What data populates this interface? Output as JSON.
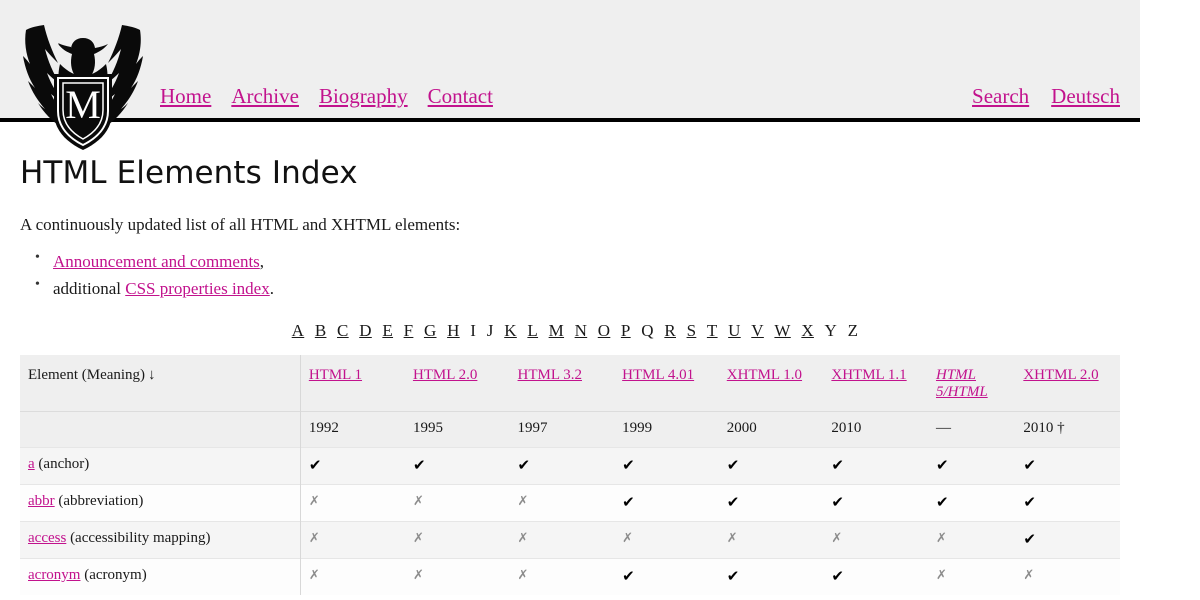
{
  "header": {
    "logo_icon": "eagle-shield-logo",
    "logo_letter": "M",
    "nav_left": [
      {
        "label": "Home"
      },
      {
        "label": "Archive"
      },
      {
        "label": "Biography"
      },
      {
        "label": "Contact"
      }
    ],
    "nav_right": [
      {
        "label": "Search"
      },
      {
        "label": "Deutsch"
      }
    ]
  },
  "main": {
    "title": "HTML Elements Index",
    "lede": "A continuously updated list of all HTML and XHTML elements:",
    "bullets": [
      {
        "link": "Announcement and comments",
        "after": ","
      },
      {
        "before": "additional ",
        "link": "CSS properties index",
        "after": "."
      }
    ]
  },
  "alphabet": [
    {
      "letter": "A",
      "linked": true
    },
    {
      "letter": "B",
      "linked": true
    },
    {
      "letter": "C",
      "linked": true
    },
    {
      "letter": "D",
      "linked": true
    },
    {
      "letter": "E",
      "linked": true
    },
    {
      "letter": "F",
      "linked": true
    },
    {
      "letter": "G",
      "linked": true
    },
    {
      "letter": "H",
      "linked": true
    },
    {
      "letter": "I",
      "linked": false
    },
    {
      "letter": "J",
      "linked": false
    },
    {
      "letter": "K",
      "linked": true
    },
    {
      "letter": "L",
      "linked": true
    },
    {
      "letter": "M",
      "linked": true
    },
    {
      "letter": "N",
      "linked": true
    },
    {
      "letter": "O",
      "linked": true
    },
    {
      "letter": "P",
      "linked": true
    },
    {
      "letter": "Q",
      "linked": false
    },
    {
      "letter": "R",
      "linked": true
    },
    {
      "letter": "S",
      "linked": true
    },
    {
      "letter": "T",
      "linked": true
    },
    {
      "letter": "U",
      "linked": true
    },
    {
      "letter": "V",
      "linked": true
    },
    {
      "letter": "W",
      "linked": true
    },
    {
      "letter": "X",
      "linked": true
    },
    {
      "letter": "Y",
      "linked": false
    },
    {
      "letter": "Z",
      "linked": false
    }
  ],
  "table": {
    "element_col_header": "Element (Meaning)",
    "sort_arrow": "↓",
    "version_columns": [
      {
        "label": "HTML 1",
        "year": "1992",
        "italic": false
      },
      {
        "label": "HTML 2.0",
        "year": "1995",
        "italic": false
      },
      {
        "label": "HTML 3.2",
        "year": "1997",
        "italic": false
      },
      {
        "label": "HTML 4.01",
        "year": "1999",
        "italic": false
      },
      {
        "label": "XHTML 1.0",
        "year": "2000",
        "italic": false
      },
      {
        "label": "XHTML 1.1",
        "year": "2010",
        "italic": false
      },
      {
        "label": "HTML 5/HTML",
        "year": "—",
        "italic": true
      },
      {
        "label": "XHTML 2.0",
        "year": "2010 †",
        "italic": false
      }
    ],
    "yes_mark": "✔",
    "no_mark": "✗",
    "rows": [
      {
        "element": "a",
        "meaning": "(anchor)",
        "support": [
          true,
          true,
          true,
          true,
          true,
          true,
          true,
          true
        ]
      },
      {
        "element": "abbr",
        "meaning": "(abbreviation)",
        "support": [
          false,
          false,
          false,
          true,
          true,
          true,
          true,
          true
        ]
      },
      {
        "element": "access",
        "meaning": "(accessibility mapping)",
        "support": [
          false,
          false,
          false,
          false,
          false,
          false,
          false,
          true
        ]
      },
      {
        "element": "acronym",
        "meaning": "(acronym)",
        "support": [
          false,
          false,
          false,
          true,
          true,
          true,
          false,
          false
        ]
      }
    ]
  },
  "colors": {
    "link": "#c2128d",
    "header_bg": "#efefef",
    "page_bg": "#ffffff",
    "yes": "#000000",
    "no": "#8c8c8c"
  }
}
